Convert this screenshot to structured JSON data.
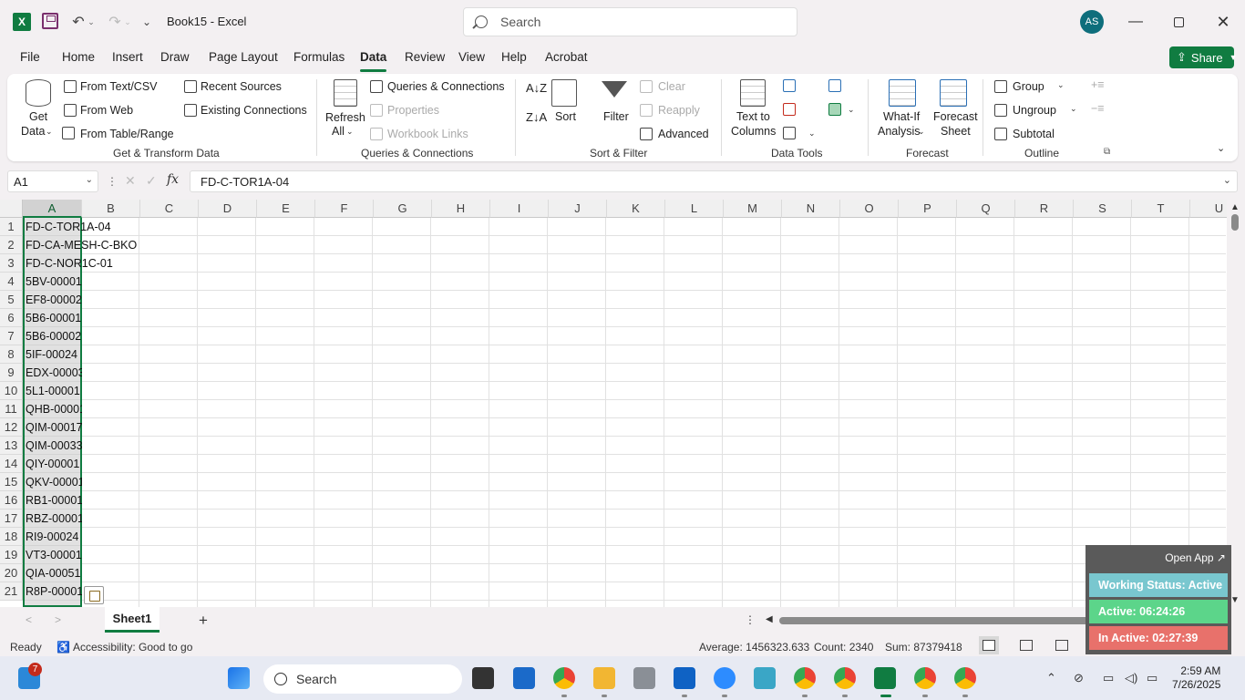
{
  "titlebar": {
    "doc_title": "Book15  -  Excel",
    "search_placeholder": "Search",
    "avatar_initials": "AS"
  },
  "tabs": [
    "File",
    "Home",
    "Insert",
    "Draw",
    "Page Layout",
    "Formulas",
    "Data",
    "Review",
    "View",
    "Help",
    "Acrobat"
  ],
  "active_tab": "Data",
  "share_label": "Share",
  "ribbon": {
    "get_data": "Get",
    "get_data2": "Data",
    "from_text_csv": "From Text/CSV",
    "from_web": "From Web",
    "from_table_range": "From Table/Range",
    "recent_sources": "Recent Sources",
    "existing_connections": "Existing Connections",
    "group_get_transform": "Get & Transform Data",
    "refresh": "Refresh",
    "refresh_all": "All",
    "queries_connections": "Queries & Connections",
    "properties": "Properties",
    "workbook_links": "Workbook Links",
    "group_queries": "Queries & Connections",
    "sort": "Sort",
    "filter": "Filter",
    "clear": "Clear",
    "reapply": "Reapply",
    "advanced": "Advanced",
    "group_sort_filter": "Sort & Filter",
    "text_to": "Text to",
    "columns": "Columns",
    "group_data_tools": "Data Tools",
    "what_if": "What-If",
    "analysis": "Analysis",
    "forecast_sheet1": "Forecast",
    "forecast_sheet2": "Sheet",
    "group_forecast": "Forecast",
    "group": "Group",
    "ungroup": "Ungroup",
    "subtotal": "Subtotal",
    "group_outline": "Outline"
  },
  "formula_bar": {
    "name_box": "A1",
    "fx": "fx",
    "content": "FD-C-TOR1A-04"
  },
  "columns": [
    "A",
    "B",
    "C",
    "D",
    "E",
    "F",
    "G",
    "H",
    "I",
    "J",
    "K",
    "L",
    "M",
    "N",
    "O",
    "P",
    "Q",
    "R",
    "S",
    "T",
    "U"
  ],
  "selected_column": "A",
  "rows": [
    "1",
    "2",
    "3",
    "4",
    "5",
    "6",
    "7",
    "8",
    "9",
    "10",
    "11",
    "12",
    "13",
    "14",
    "15",
    "16",
    "17",
    "18",
    "19",
    "20",
    "21"
  ],
  "cells_a": [
    "FD-C-TOR1A-04",
    "FD-CA-MESH-C-BKO",
    "FD-C-NOR1C-01",
    "5BV-00001",
    "EF8-00002",
    "5B6-00001",
    "5B6-00002",
    "5IF-00024",
    "EDX-00003",
    "5L1-00001",
    "QHB-00001",
    "QIM-00017",
    "QIM-00033",
    "QIY-00001",
    "QKV-00001",
    "RB1-00001",
    "RBZ-00001",
    "RI9-00024",
    "VT3-00001",
    "QIA-00051",
    "R8P-00001"
  ],
  "sheet_tab": "Sheet1",
  "status": {
    "ready": "Ready",
    "accessibility": "Accessibility: Good to go",
    "average": "Average: 1456323.633",
    "count": "Count: 2340",
    "sum": "Sum: 87379418"
  },
  "widget": {
    "open_app": "Open App ↗",
    "working_status": "Working Status: Active",
    "active": "Active: 06:24:26",
    "inactive": "In Active: 02:27:39"
  },
  "taskbar": {
    "search": "Search",
    "badge": "7",
    "time": "2:59 AM",
    "date": "7/26/2025"
  },
  "colors": {
    "excel_green": "#107c41",
    "widget_status": "#79c7cf",
    "widget_active": "#5cd58a",
    "widget_inactive": "#e8716b"
  }
}
